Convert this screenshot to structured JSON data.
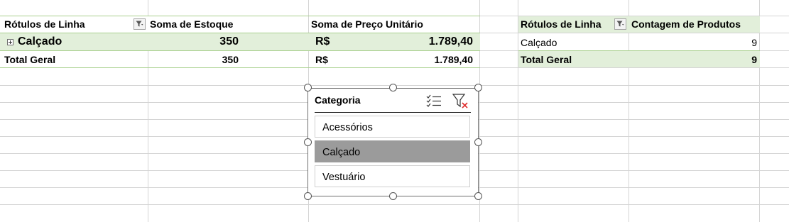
{
  "pivot1": {
    "headers": {
      "row_labels": "Rótulos de Linha",
      "stock_sum": "Soma de Estoque",
      "price_sum": "Soma de Preço Unitário"
    },
    "rows": [
      {
        "label": "Calçado",
        "stock": "350",
        "currency": "R$",
        "price": "1.789,40"
      }
    ],
    "total": {
      "label": "Total Geral",
      "stock": "350",
      "currency": "R$",
      "price": "1.789,40"
    }
  },
  "pivot2": {
    "headers": {
      "row_labels": "Rótulos de Linha",
      "count": "Contagem de Produtos"
    },
    "rows": [
      {
        "label": "Calçado",
        "count": "9"
      }
    ],
    "total": {
      "label": "Total Geral",
      "count": "9"
    }
  },
  "slicer": {
    "title": "Categoria",
    "items": [
      {
        "label": "Acessórios",
        "selected": false
      },
      {
        "label": "Calçado",
        "selected": true
      },
      {
        "label": "Vestuário",
        "selected": false
      }
    ],
    "icons": [
      "multi-select-icon",
      "clear-filter-icon"
    ]
  },
  "colors": {
    "header_fill": "#e2efda",
    "header_border": "#a9d08e",
    "selected_item": "#9b9b9b",
    "gridline": "#d4d4d4",
    "clear_filter_x": "#e03030"
  }
}
